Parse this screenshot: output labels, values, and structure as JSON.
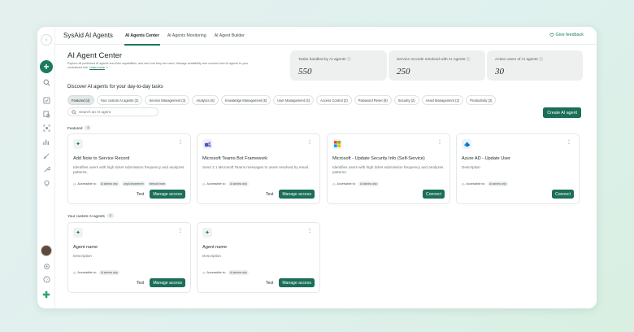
{
  "app": {
    "title": "SysAid AI Agents"
  },
  "tabs": [
    {
      "label": "AI Agents Center"
    },
    {
      "label": "AI Agents Monitoring"
    },
    {
      "label": "AI Agent Builder"
    }
  ],
  "header": {
    "feedback_label": "Give feedback"
  },
  "page": {
    "title": "AI Agent Center",
    "description": "Explore all published AI agents and their capabilities, and see how they are used. Manage availability and connect new AI agents to your",
    "description_2": "centralized hub.",
    "learn_more": "Learn more"
  },
  "stats": [
    {
      "label": "Tasks handled by AI agents",
      "value": "550"
    },
    {
      "label": "Service records resolved with AI Agents",
      "value": "250"
    },
    {
      "label": "Active users of AI agents",
      "value": "30"
    }
  ],
  "discover": {
    "heading": "Discover AI agents for your day-to-day tasks"
  },
  "chips": [
    {
      "label": "Featured (4)"
    },
    {
      "label": "Your custom AI agents (2)"
    },
    {
      "label": "Service Management (3)"
    },
    {
      "label": "Analytics (5)"
    },
    {
      "label": "Knowledge Management (5)"
    },
    {
      "label": "User Management (2)"
    },
    {
      "label": "Access Control (2)"
    },
    {
      "label": "Password Reset (5)"
    },
    {
      "label": "Security (2)"
    },
    {
      "label": "Asset Management (2)"
    },
    {
      "label": "Productivity (3)"
    }
  ],
  "search": {
    "placeholder": "Search an AI agent"
  },
  "create_button": "Create AI agent",
  "sections": {
    "featured": {
      "label": "Featured",
      "count": "4"
    },
    "custom": {
      "label": "Your custom AI agents",
      "count": "2"
    }
  },
  "accessible_label": "Accessible to:",
  "featured_cards": [
    {
      "title": "Add Note to Service Record",
      "desc": "Identifies users with high ticket submission frequency and analyzes patterns.",
      "tags": [
        "AI admins only",
        "Legal department",
        "Network team"
      ],
      "secondary": "Test",
      "primary": "Manage access",
      "icon": "sparkle-icon"
    },
    {
      "title": "Microsoft Teams Bot Framework",
      "desc": "Send 1:1 Microsoft Teams messages to users resolved by email.",
      "tags": [
        "AI admins only"
      ],
      "secondary": "Test",
      "primary": "Manage access",
      "icon": "teams-icon"
    },
    {
      "title": "Microsoft - Update Security Info (Self-Service)",
      "desc": "Identifies users with high ticket submission frequency and analyzes patterns.",
      "tags": [
        "AI admins only"
      ],
      "secondary": "",
      "primary": "Connect",
      "icon": "microsoft-icon"
    },
    {
      "title": "Azure AD - Update User",
      "desc": "Description",
      "tags": [
        "AI admins only"
      ],
      "secondary": "",
      "primary": "Connect",
      "icon": "azure-icon"
    }
  ],
  "custom_cards": [
    {
      "title": "Agent name",
      "desc": "Description",
      "tags": [
        "AI admins only"
      ],
      "secondary": "Test",
      "primary": "Manage access",
      "icon": "sparkle-icon"
    },
    {
      "title": "Agent name",
      "desc": "Description",
      "tags": [
        "AI admins only"
      ],
      "secondary": "Test",
      "primary": "Manage access",
      "icon": "sparkle-icon"
    }
  ],
  "colors": {
    "accent": "#1b6e58",
    "brand_green": "#2fa46b"
  }
}
